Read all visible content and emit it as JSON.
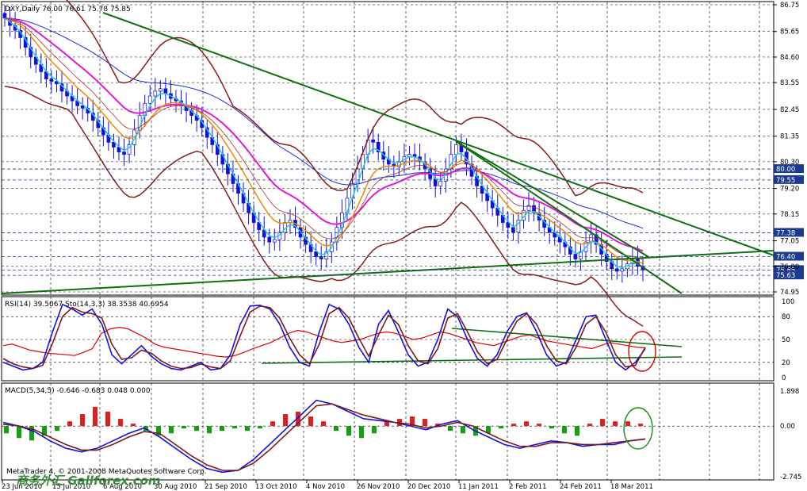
{
  "chart_data": [
    {
      "type": "candlestick",
      "title": "DXY,Daily  76.00 76.61 75.78 75.85",
      "ylim": [
        74.95,
        86.75
      ],
      "y_ticks": [
        "86.75",
        "85.65",
        "84.60",
        "83.55",
        "82.45",
        "81.35",
        "80.30",
        "79.20",
        "78.15",
        "77.05",
        "76.00",
        "74.95"
      ],
      "price_labels": [
        {
          "value": 80.0,
          "text": "80.00",
          "color": "#1d3b8c"
        },
        {
          "value": 79.55,
          "text": "79.55",
          "color": "#1d3b8c"
        },
        {
          "value": 77.38,
          "text": "77.38",
          "color": "#1d3b8c"
        },
        {
          "value": 76.4,
          "text": "76.40",
          "color": "#1d3b8c"
        },
        {
          "value": 75.85,
          "text": "75.85",
          "color": "#1d3b8c"
        },
        {
          "value": 75.63,
          "text": "75.63",
          "color": "#1d3b8c"
        }
      ],
      "close": [
        86.2,
        85.9,
        85.7,
        85.4,
        85.0,
        84.6,
        84.3,
        84.0,
        83.7,
        83.6,
        83.5,
        83.2,
        83.0,
        82.8,
        82.6,
        82.5,
        82.3,
        82.0,
        81.7,
        81.4,
        81.1,
        80.9,
        80.7,
        80.6,
        81.0,
        81.6,
        82.2,
        82.7,
        83.0,
        83.2,
        83.3,
        83.1,
        82.9,
        82.8,
        82.6,
        82.4,
        82.2,
        82.0,
        81.7,
        81.3,
        81.0,
        80.6,
        80.2,
        79.8,
        79.4,
        79.0,
        78.6,
        78.2,
        77.8,
        77.5,
        77.2,
        77.0,
        77.1,
        77.4,
        77.8,
        77.9,
        77.6,
        77.2,
        76.9,
        76.6,
        76.4,
        76.3,
        76.6,
        77.0,
        77.6,
        78.2,
        78.8,
        79.4,
        80.0,
        80.6,
        81.2,
        81.1,
        80.7,
        80.4,
        80.2,
        80.1,
        80.3,
        80.5,
        80.6,
        80.5,
        80.3,
        80.0,
        79.6,
        79.3,
        79.5,
        80.0,
        80.6,
        81.0,
        80.7,
        80.2,
        79.7,
        79.3,
        79.0,
        78.7,
        78.4,
        78.1,
        77.8,
        77.6,
        77.4,
        77.9,
        78.3,
        78.5,
        78.2,
        77.9,
        77.6,
        77.4,
        77.2,
        77.0,
        76.8,
        76.5,
        76.3,
        76.6,
        77.0,
        77.3,
        76.9,
        76.5,
        76.2,
        75.9,
        75.8,
        75.9,
        76.1,
        76.3,
        76.0,
        75.85
      ],
      "lines": [
        {
          "name": "EMA fast",
          "color": "#27c6e0"
        },
        {
          "name": "EMA mid",
          "color": "#f08a00"
        },
        {
          "name": "EMA slow",
          "color": "#e018d8"
        },
        {
          "name": "MA long",
          "color": "#1d2ed8"
        },
        {
          "name": "Bollinger Bands",
          "color": "#8b1a1a"
        }
      ],
      "trendlines_color": "#107010"
    },
    {
      "type": "line",
      "title": "RSI(14) 39.5067  Sto(14,3,3) 38.3538 40.6954",
      "ylim": [
        0,
        100
      ],
      "y_ticks": [
        "100",
        "80",
        "50",
        "20",
        "0"
      ],
      "levels": [
        20,
        50,
        80
      ],
      "series": [
        {
          "name": "RSI(14)",
          "color": "#e00000",
          "values": [
            42,
            44,
            40,
            36,
            34,
            32,
            31,
            30,
            29,
            33,
            38,
            58,
            64,
            66,
            64,
            58,
            52,
            44,
            40,
            38,
            36,
            34,
            32,
            30,
            28,
            27,
            29,
            33,
            38,
            42,
            46,
            52,
            58,
            62,
            60,
            56,
            52,
            48,
            46,
            48,
            50,
            54,
            58,
            60,
            58,
            54,
            50,
            52,
            56,
            60,
            58,
            54,
            50,
            46,
            44,
            42,
            46,
            50,
            54,
            56,
            52,
            48,
            46,
            44,
            42,
            40,
            38,
            42,
            46,
            44,
            42,
            40,
            39
          ]
        },
        {
          "name": "Sto main",
          "color": "#1010e0",
          "values": [
            20,
            15,
            10,
            12,
            20,
            60,
            96,
            90,
            82,
            90,
            70,
            30,
            18,
            30,
            42,
            28,
            18,
            12,
            10,
            15,
            20,
            10,
            12,
            30,
            70,
            94,
            95,
            90,
            70,
            40,
            20,
            15,
            60,
            96,
            90,
            70,
            40,
            20,
            70,
            88,
            60,
            30,
            15,
            20,
            50,
            90,
            80,
            50,
            25,
            15,
            30,
            60,
            80,
            85,
            60,
            30,
            15,
            20,
            50,
            80,
            82,
            50,
            20,
            10,
            20,
            38
          ]
        },
        {
          "name": "Sto signal",
          "color": "#7a1a1a",
          "values": [
            25,
            18,
            14,
            12,
            16,
            45,
            80,
            92,
            86,
            84,
            78,
            44,
            24,
            26,
            36,
            32,
            22,
            15,
            12,
            13,
            18,
            14,
            12,
            22,
            55,
            86,
            94,
            92,
            78,
            52,
            30,
            18,
            44,
            84,
            92,
            78,
            52,
            28,
            56,
            82,
            70,
            42,
            22,
            18,
            38,
            78,
            84,
            60,
            34,
            18,
            24,
            50,
            74,
            84,
            70,
            42,
            22,
            18,
            40,
            70,
            80,
            60,
            30,
            14,
            16,
            40
          ]
        }
      ]
    },
    {
      "type": "bar",
      "title": "MACD(5,34,5) -0.646 -0.683 0.048 0.000",
      "ylim": [
        -2.745,
        1.898
      ],
      "y_ticks": [
        "1.898",
        "0.00",
        "-2.745"
      ],
      "histogram": [
        -0.3,
        -0.5,
        -0.6,
        -0.4,
        -0.2,
        0.2,
        0.5,
        0.8,
        0.6,
        0.3,
        0.1,
        -0.2,
        -0.4,
        -0.3,
        -0.1,
        -0.2,
        -0.3,
        -0.2,
        -0.1,
        -0.2,
        -0.1,
        0.2,
        0.5,
        0.6,
        0.4,
        0.2,
        -0.2,
        -0.4,
        -0.5,
        -0.3,
        0.2,
        0.3,
        0.4,
        0.3,
        0.1,
        -0.2,
        -0.3,
        -0.4,
        -0.3,
        -0.1,
        0.1,
        0.2,
        0.1,
        -0.1,
        -0.3,
        -0.4,
        0.1,
        0.3,
        0.2,
        0.2,
        0.1
      ],
      "series": [
        {
          "name": "MACD",
          "color": "#1010e0",
          "values": [
            0.2,
            0.0,
            -0.3,
            -0.8,
            -1.2,
            -1.4,
            -1.2,
            -0.8,
            -0.4,
            -0.1,
            -0.6,
            -1.2,
            -1.8,
            -2.3,
            -2.5,
            -2.4,
            -1.8,
            -1.0,
            -0.2,
            0.6,
            1.4,
            1.2,
            0.8,
            0.4,
            0.3,
            0.2,
            0.0,
            -0.2,
            0.1,
            0.3,
            -0.2,
            -0.6,
            -1.0,
            -1.2,
            -1.0,
            -0.8,
            -0.9,
            -1.1,
            -1.0,
            -1.0,
            -0.8,
            -0.7
          ]
        },
        {
          "name": "Signal",
          "color": "#7a1a1a",
          "values": [
            0.1,
            0.0,
            -0.2,
            -0.6,
            -1.0,
            -1.3,
            -1.3,
            -1.0,
            -0.6,
            -0.3,
            -0.4,
            -1.0,
            -1.6,
            -2.1,
            -2.4,
            -2.4,
            -2.0,
            -1.3,
            -0.5,
            0.3,
            1.1,
            1.2,
            0.9,
            0.6,
            0.4,
            0.2,
            0.1,
            -0.1,
            0.0,
            0.2,
            0.0,
            -0.4,
            -0.8,
            -1.1,
            -1.1,
            -0.9,
            -0.9,
            -1.0,
            -1.0,
            -0.9,
            -0.8,
            -0.7
          ]
        }
      ]
    }
  ],
  "x_labels": [
    "23 Jun 2010",
    "15 Jul 2010",
    "6 Aug 2010",
    "30 Aug 2010",
    "21 Sep 2010",
    "13 Oct 2010",
    "4 Nov 2010",
    "26 Nov 2010",
    "20 Dec 2010",
    "11 Jan 2011",
    "2 Feb 2011",
    "24 Feb 2011",
    "18 Mar 2011"
  ],
  "copyright": "MetaTrader 4, © 2001-2008 MetaQuotes Software Corp.",
  "watermark": "商务外汇 Gallforex.com",
  "colors": {
    "grid": "#000000",
    "axis": "#000000",
    "bear_candle": "#1010e0",
    "bull_candle": "#1010e0",
    "annotation_circle_red": "#e00000",
    "annotation_circle_green": "#109010"
  }
}
